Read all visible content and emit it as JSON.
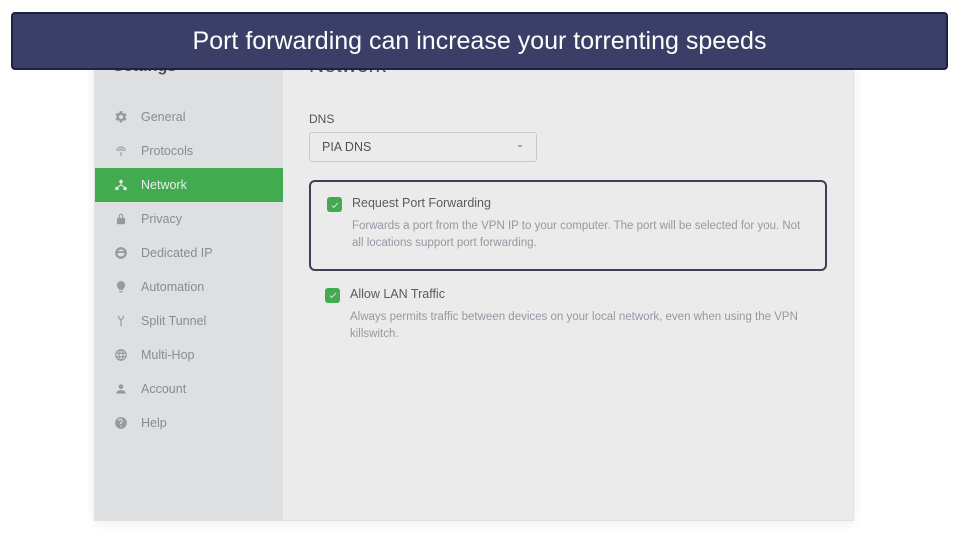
{
  "caption": "Port forwarding can increase your torrenting speeds",
  "sidebar": {
    "title": "Settings",
    "items": [
      {
        "label": "General"
      },
      {
        "label": "Protocols"
      },
      {
        "label": "Network"
      },
      {
        "label": "Privacy"
      },
      {
        "label": "Dedicated IP"
      },
      {
        "label": "Automation"
      },
      {
        "label": "Split Tunnel"
      },
      {
        "label": "Multi-Hop"
      },
      {
        "label": "Account"
      },
      {
        "label": "Help"
      }
    ],
    "active_index": 2
  },
  "content": {
    "title": "Network",
    "dns_label": "DNS",
    "dns_value": "PIA DNS",
    "options": [
      {
        "title": "Request Port Forwarding",
        "desc": "Forwards a port from the VPN IP to your computer. The port will be selected for you. Not all locations support port forwarding.",
        "checked": true
      },
      {
        "title": "Allow LAN Traffic",
        "desc": "Always permits traffic between devices on your local network, even when using the VPN killswitch.",
        "checked": true
      }
    ]
  }
}
